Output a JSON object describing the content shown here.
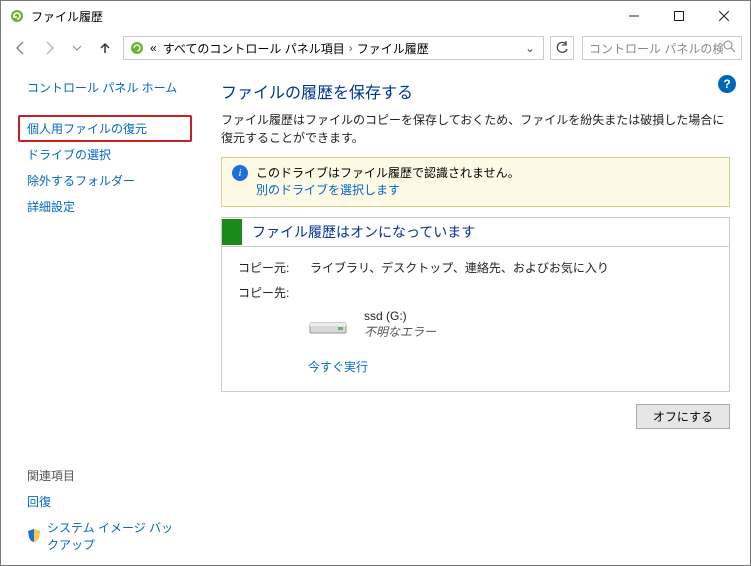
{
  "titlebar": {
    "title": "ファイル履歴"
  },
  "breadcrumb": {
    "prefix": "«",
    "items": [
      "すべてのコントロール パネル項目",
      "ファイル履歴"
    ]
  },
  "search": {
    "placeholder": "コントロール パネルの検索"
  },
  "sidebar": {
    "home": "コントロール パネル ホーム",
    "restore": "個人用ファイルの復元",
    "drive": "ドライブの選択",
    "exclude": "除外するフォルダー",
    "advanced": "詳細設定",
    "related_label": "関連項目",
    "recovery": "回復",
    "backup": "システム イメージ バックアップ"
  },
  "content": {
    "heading": "ファイルの履歴を保存する",
    "description": "ファイル履歴はファイルのコピーを保存しておくため、ファイルを紛失または破損した場合に復元することができます。",
    "notice_text": "このドライブはファイル履歴で認識されません。",
    "notice_link": "別のドライブを選択します",
    "panel_title": "ファイル履歴はオンになっています",
    "copy_from_label": "コピー元:",
    "copy_from_value": "ライブラリ、デスクトップ、連絡先、およびお気に入り",
    "copy_to_label": "コピー先:",
    "drive_name": "ssd (G:)",
    "drive_error": "不明なエラー",
    "run_now": "今すぐ実行",
    "off_button": "オフにする"
  }
}
